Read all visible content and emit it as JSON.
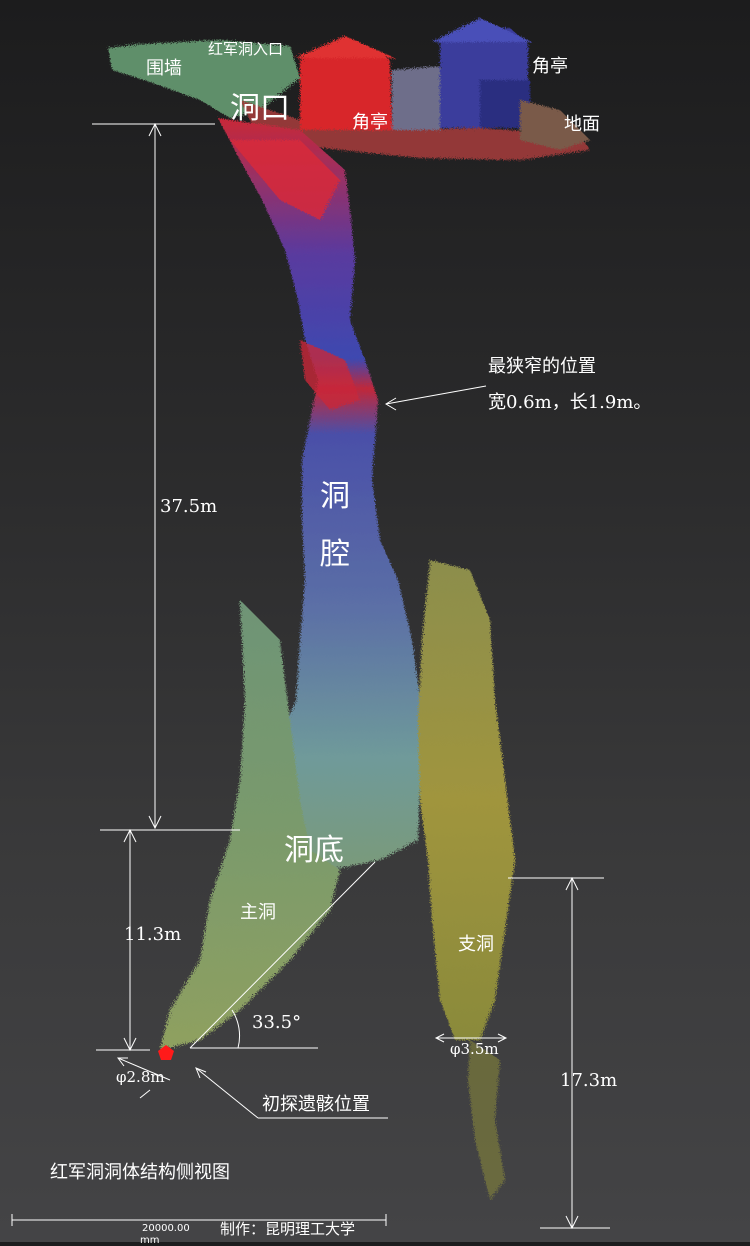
{
  "labels": {
    "wall": "围墙",
    "entrance": "红军洞入口",
    "pavilion_right": "角亭",
    "cave_mouth": "洞口",
    "pavilion_center": "角亭",
    "ground": "地面",
    "narrowest_title": "最狭窄的位置",
    "narrowest_detail": "宽0.6m，长1.9m。",
    "cavity_1": "洞",
    "cavity_2": "腔",
    "bottom": "洞底",
    "main_cave": "主洞",
    "branch_cave": "支洞",
    "remains_position": "初探遗骸位置",
    "title": "红军洞洞体结构侧视图",
    "credit": "制作：昆明理工大学",
    "scale_value": "20000.00",
    "scale_unit": "mm"
  },
  "dimensions": {
    "depth_main": "37.5m",
    "depth_bottom": "11.3m",
    "depth_branch": "17.3m",
    "angle": "33.5°",
    "diameter_main": "φ2.8m",
    "diameter_branch": "φ3.5m"
  },
  "colors": {
    "background_top": "#1c1c1d",
    "background_bottom": "#444446",
    "pavilion_red": "#d8282c",
    "pavilion_blue": "#3a3d9c",
    "wall_green": "#5f8f6a",
    "shaft_blue": "#4a56a8",
    "shaft_red": "#c8283a",
    "main_cave_green": "#6f8f6a",
    "branch_cave_olive": "#9a9040",
    "marker_red": "#ff1a1a",
    "line_white": "#ffffff"
  }
}
